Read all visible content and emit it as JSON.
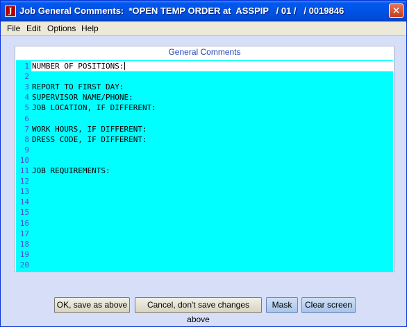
{
  "window": {
    "title": "Job General Comments:  *OPEN TEMP ORDER at  ASSPIP   / 01 /   / 0019846",
    "app_icon_glyph": "J",
    "close_glyph": "✕"
  },
  "menu": [
    {
      "label": "File"
    },
    {
      "label": "Edit"
    },
    {
      "label": "Options"
    },
    {
      "label": "Help"
    }
  ],
  "panel": {
    "header": "General Comments"
  },
  "editor": {
    "lines": [
      {
        "no": "1",
        "text": "NUMBER OF POSITIONS:"
      },
      {
        "no": "2",
        "text": ""
      },
      {
        "no": "3",
        "text": "REPORT TO FIRST DAY:"
      },
      {
        "no": "4",
        "text": "SUPERVISOR NAME/PHONE:"
      },
      {
        "no": "5",
        "text": "JOB LOCATION, IF DIFFERENT:"
      },
      {
        "no": "6",
        "text": ""
      },
      {
        "no": "7",
        "text": "WORK HOURS, IF DIFFERENT:"
      },
      {
        "no": "8",
        "text": "DRESS CODE, IF DIFFERENT:"
      },
      {
        "no": "9",
        "text": ""
      },
      {
        "no": "10",
        "text": ""
      },
      {
        "no": "11",
        "text": "JOB REQUIREMENTS:"
      },
      {
        "no": "12",
        "text": ""
      },
      {
        "no": "13",
        "text": ""
      },
      {
        "no": "14",
        "text": ""
      },
      {
        "no": "15",
        "text": ""
      },
      {
        "no": "16",
        "text": ""
      },
      {
        "no": "17",
        "text": ""
      },
      {
        "no": "18",
        "text": ""
      },
      {
        "no": "19",
        "text": ""
      },
      {
        "no": "20",
        "text": ""
      }
    ]
  },
  "buttons": {
    "ok": "OK, save as above",
    "cancel": "Cancel, don't save changes above",
    "mask": "Mask",
    "clear": "Clear screen"
  }
}
